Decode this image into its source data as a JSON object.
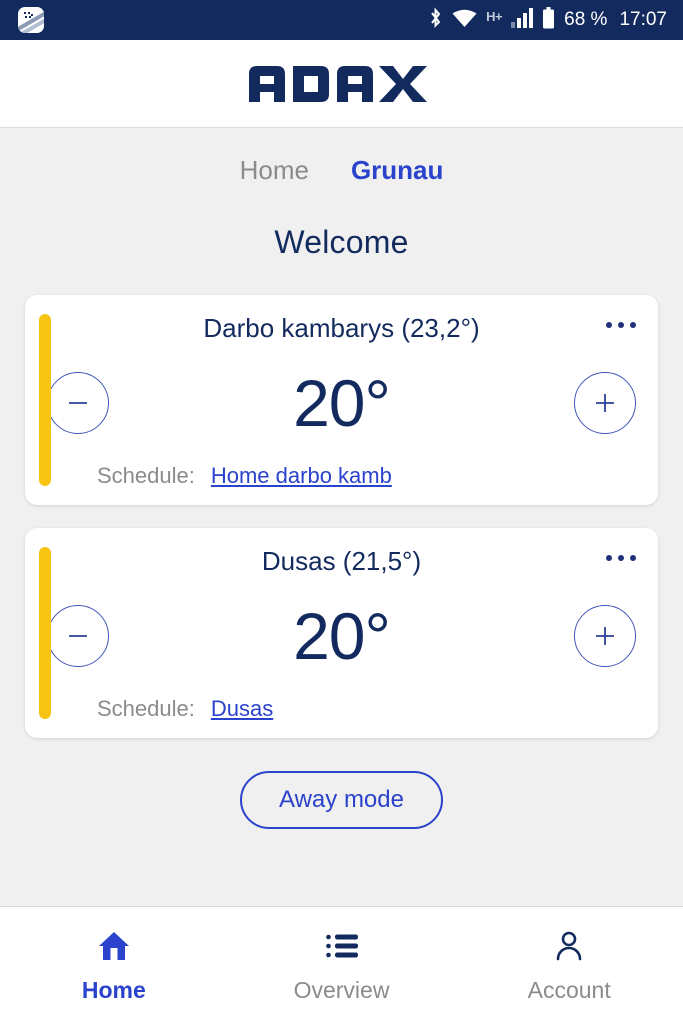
{
  "statusbar": {
    "app_icon": "blackberry-app-icon",
    "bluetooth_icon": "bluetooth-icon",
    "wifi_icon": "wifi-icon",
    "network_type": "H+",
    "signal_icon": "signal-bars-icon",
    "battery_icon": "battery-icon",
    "battery_text": "68 %",
    "time": "17:07",
    "bg_color": "#132a5e"
  },
  "brand": {
    "name": "ADAX",
    "color": "#132a5e"
  },
  "breadcrumb": {
    "items": [
      {
        "label": "Home",
        "active": false
      },
      {
        "label": "Grunau",
        "active": true
      }
    ]
  },
  "page_title": "Welcome",
  "rooms": [
    {
      "title": "Darbo kambarys (23,2°)",
      "name": "Darbo kambarys",
      "current_temperature": "23,2°",
      "setpoint": "20°",
      "schedule_label": "Schedule:",
      "schedule_name": "Home darbo kamb",
      "accent_color": "#f8c413",
      "decrease_icon": "minus-circle-icon",
      "increase_icon": "plus-circle-icon",
      "menu_icon": "more-options-icon"
    },
    {
      "title": "Dusas (21,5°)",
      "name": "Dusas",
      "current_temperature": "21,5°",
      "setpoint": "20°",
      "schedule_label": "Schedule:",
      "schedule_name": "Dusas",
      "accent_color": "#f8c413",
      "decrease_icon": "minus-circle-icon",
      "increase_icon": "plus-circle-icon",
      "menu_icon": "more-options-icon"
    }
  ],
  "away_button": {
    "label": "Away mode",
    "color": "#2b43cc"
  },
  "bottom_nav": {
    "items": [
      {
        "label": "Home",
        "icon": "home-icon",
        "active": true
      },
      {
        "label": "Overview",
        "icon": "list-icon",
        "active": false
      },
      {
        "label": "Account",
        "icon": "person-icon",
        "active": false
      }
    ],
    "active_color": "#2b43cc",
    "inactive_color": "#8b8b8b"
  }
}
